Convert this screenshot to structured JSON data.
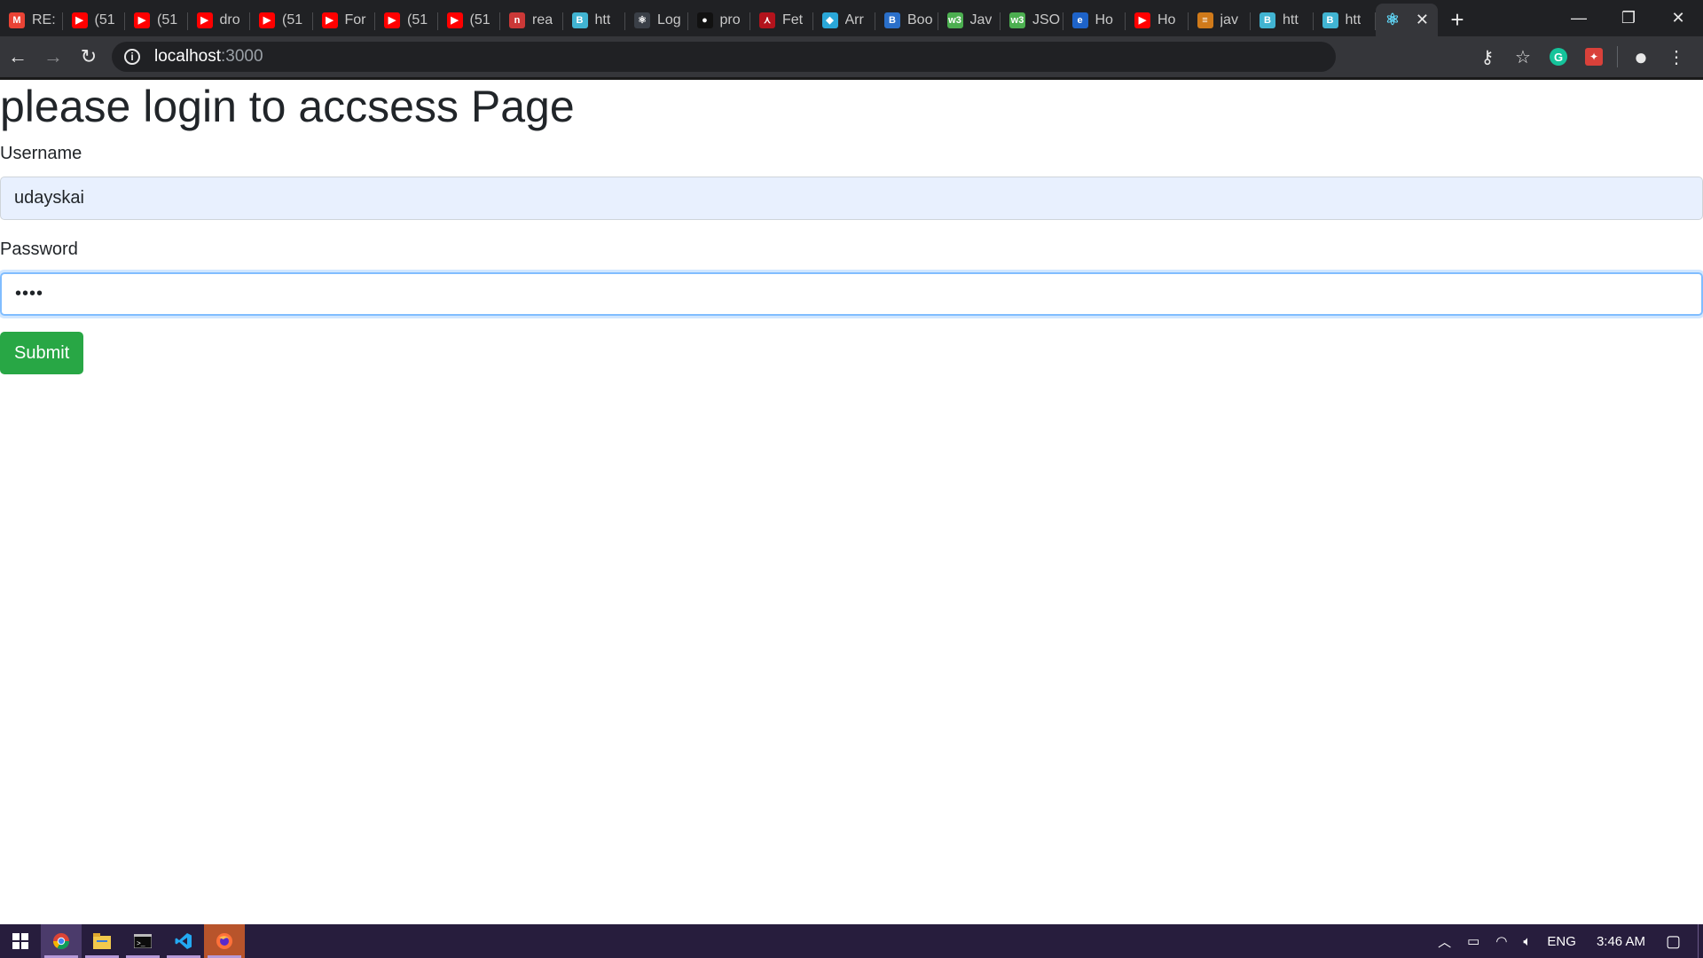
{
  "browser": {
    "tabs": [
      {
        "fav": "gmail-icon",
        "favtext": "M",
        "color": "#ea4335",
        "label": "RE:"
      },
      {
        "fav": "youtube-icon",
        "favtext": "▶",
        "color": "#ff0000",
        "label": "(51"
      },
      {
        "fav": "youtube-icon",
        "favtext": "▶",
        "color": "#ff0000",
        "label": "(51"
      },
      {
        "fav": "youtube-icon",
        "favtext": "▶",
        "color": "#ff0000",
        "label": "dro"
      },
      {
        "fav": "youtube-icon",
        "favtext": "▶",
        "color": "#ff0000",
        "label": "(51"
      },
      {
        "fav": "youtube-icon",
        "favtext": "▶",
        "color": "#ff0000",
        "label": "For"
      },
      {
        "fav": "youtube-icon",
        "favtext": "▶",
        "color": "#ff0000",
        "label": "(51"
      },
      {
        "fav": "youtube-icon",
        "favtext": "▶",
        "color": "#ff0000",
        "label": "(51"
      },
      {
        "fav": "npm-icon",
        "favtext": "n",
        "color": "#cb3837",
        "label": "rea"
      },
      {
        "fav": "react-bootstrap-icon",
        "favtext": "B",
        "color": "#41b4d2",
        "label": "htt"
      },
      {
        "fav": "react-icon",
        "favtext": "⚛",
        "color": "#3a3f47",
        "label": "Log"
      },
      {
        "fav": "github-icon",
        "favtext": "●",
        "color": "#111111",
        "label": "pro"
      },
      {
        "fav": "feathers-icon",
        "favtext": "⋏",
        "color": "#b3131c",
        "label": "Fet"
      },
      {
        "fav": "bookmark-icon",
        "favtext": "◆",
        "color": "#2aa7d8",
        "label": "Arr"
      },
      {
        "fav": "bootstrap-icon",
        "favtext": "B",
        "color": "#2a6fc9",
        "label": "Boo"
      },
      {
        "fav": "w3schools-icon",
        "favtext": "w3",
        "color": "#4caf50",
        "label": "Jav"
      },
      {
        "fav": "w3schools-icon",
        "favtext": "w3",
        "color": "#4caf50",
        "label": "JSO"
      },
      {
        "fav": "edureka-icon",
        "favtext": "e",
        "color": "#1e63c8",
        "label": "Ho"
      },
      {
        "fav": "youtube-icon",
        "favtext": "▶",
        "color": "#ff0000",
        "label": "Ho"
      },
      {
        "fav": "stackoverflow-icon",
        "favtext": "≡",
        "color": "#d07a1a",
        "label": "jav"
      },
      {
        "fav": "react-bootstrap-icon",
        "favtext": "B",
        "color": "#41b4d2",
        "label": "htt"
      },
      {
        "fav": "react-bootstrap-icon",
        "favtext": "B",
        "color": "#41b4d2",
        "label": "htt"
      }
    ],
    "active_tab": {
      "fav": "react-icon",
      "favtext": "⚛",
      "color": "#61dafb",
      "label": ""
    },
    "address": {
      "host": "localhost",
      "port": ":3000"
    }
  },
  "page": {
    "title": "please login to accsess Page",
    "username_label": "Username",
    "username_value": "udayskai",
    "password_label": "Password",
    "password_value": "••••",
    "submit_label": "Submit"
  },
  "taskbar": {
    "apps": [
      "windows-start-icon",
      "chrome-icon",
      "file-explorer-icon",
      "terminal-icon",
      "vscode-icon",
      "firefox-icon"
    ],
    "language": "ENG",
    "time": "3:46 AM"
  }
}
